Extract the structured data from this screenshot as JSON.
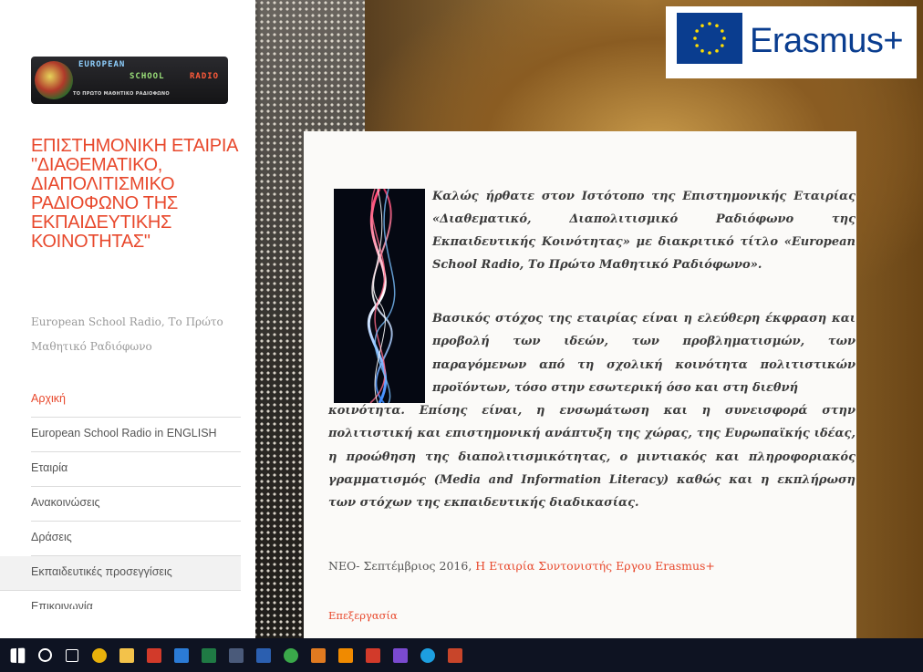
{
  "logo": {
    "line1": "EUROPEAN",
    "line2a": "SCHOOL",
    "line2b": "RADIO",
    "tagline": "ΤΟ ΠΡΩΤΟ ΜΑΘΗΤΙΚΟ ΡΑΔΙΟΦΩΝΟ"
  },
  "site": {
    "title": "ΕΠΙΣΤΗΜΟΝΙΚΗ ΕΤΑΙΡΙΑ \"ΔΙΑΘΕΜΑΤΙΚΟ, ΔΙΑΠΟΛΙΤΙΣΜΙΚΟ ΡΑΔΙΟΦΩΝΟ ΤΗΣ ΕΚΠΑΙΔΕΥΤΙΚΗΣ ΚΟΙΝΟΤΗΤΑΣ\"",
    "subtitle": "European School Radio, Το Πρώτο Μαθητικό Ραδιόφωνο"
  },
  "nav": {
    "items": [
      {
        "label": "Αρχική"
      },
      {
        "label": "European School Radio in ENGLISH"
      },
      {
        "label": "Εταιρία"
      },
      {
        "label": "Ανακοινώσεις"
      },
      {
        "label": "Δράσεις"
      },
      {
        "label": "Εκπαιδευτικές προσεγγίσεις"
      },
      {
        "label": "Επικοινωνία"
      }
    ]
  },
  "erasmus": {
    "wordmark": "Erasmus+",
    "flag_color": "#0a3d8f",
    "star_color": "#ffdd00"
  },
  "content": {
    "intro": "Καλώς ήρθατε στον Ιστότοπο της Επιστημονικής Εταιρίας «Διαθεματικό, Διαπολιτισμικό Ραδιόφωνο της Εκπαιδευτικής Κοινότητας» με διακριτικό τίτλο «European School Radio, Το Πρώτο Μαθητικό Ραδιόφωνο».",
    "goal_lead": "Βασικός στόχος της εταιρίας είναι η ελεύθερη έκφραση και προβολή των ιδεών, των προβληματισμών, των παραγόμενων από τη σχολική κοινότητα πολιτιστικών προϊόντων, τόσο στην εσωτερική όσο και στη διεθνή",
    "goal_rest": "κοινότητα. Επίσης είναι, η ενσωμάτωση και η συνεισφορά στην πολιτιστική και επιστημονική ανάπτυξη της χώρας, της Ευρωπαϊκής ιδέας, η προώθηση της διαπολιτισμικότητας, ο μιντιακός και πληροφοριακός γραμματισμός (Media and Information Literacy) καθώς και η εκπλήρωση των στόχων της εκπαιδευτικής διαδικασίας.",
    "news_prefix": "ΝΕΟ- Σεπτέμβριος 2016,",
    "news_link": "Η Εταιρία Συντονιστής Εργου Erasmus+",
    "edit_link": "Επεξεργασία"
  },
  "taskbar": {
    "icons": [
      {
        "name": "windows-start-icon",
        "color": "#ffffff"
      },
      {
        "name": "search-icon",
        "color": "#ffffff"
      },
      {
        "name": "task-view-icon",
        "color": "#ffffff"
      },
      {
        "name": "chrome-icon",
        "color": "#e8b10b"
      },
      {
        "name": "file-explorer-icon",
        "color": "#f3c24a"
      },
      {
        "name": "acrobat-icon",
        "color": "#d23a2a"
      },
      {
        "name": "app-blue-icon",
        "color": "#2b7bd6"
      },
      {
        "name": "excel-icon",
        "color": "#1f7a44"
      },
      {
        "name": "app-dark-icon",
        "color": "#4a5a7a"
      },
      {
        "name": "word-icon",
        "color": "#2b5fb0"
      },
      {
        "name": "app-green-icon",
        "color": "#3aa84a"
      },
      {
        "name": "app-orange-icon",
        "color": "#e07a20"
      },
      {
        "name": "vlc-icon",
        "color": "#f08a00"
      },
      {
        "name": "app-red-icon",
        "color": "#d23a2a"
      },
      {
        "name": "app-purple-icon",
        "color": "#7a4ad0"
      },
      {
        "name": "skype-icon",
        "color": "#1d9fe0"
      },
      {
        "name": "powerpoint-icon",
        "color": "#c8452a"
      }
    ]
  }
}
